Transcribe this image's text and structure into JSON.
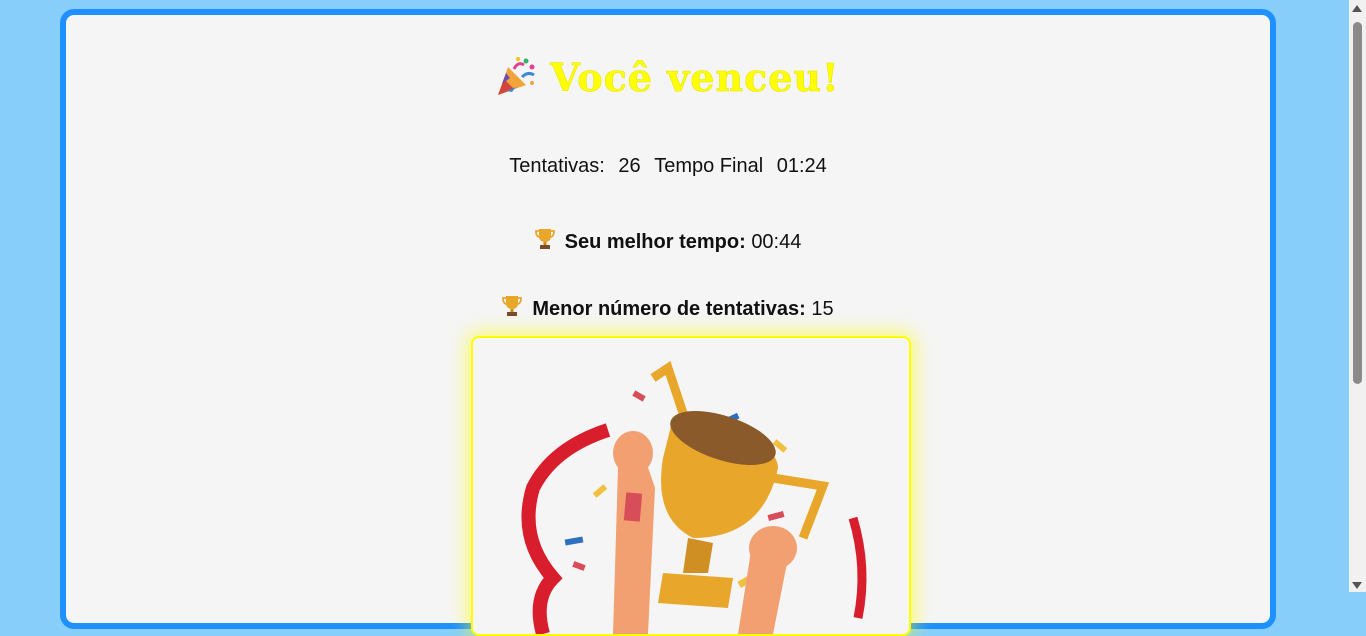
{
  "title": "Você venceu!",
  "stats": {
    "attempts_label": "Tentativas:",
    "attempts_value": "26",
    "time_label": "Tempo Final",
    "time_value": "01:24"
  },
  "records": {
    "best_time_label": "Seu melhor tempo:",
    "best_time_value": "00:44",
    "min_attempts_label": "Menor número de tentativas:",
    "min_attempts_value": "15"
  },
  "icons": {
    "title": "party-popper-icon",
    "record": "trophy-icon"
  },
  "colors": {
    "page_bg": "#87cefa",
    "card_border": "#1e90ff",
    "title": "#ffff00",
    "image_border": "#ffff00"
  }
}
